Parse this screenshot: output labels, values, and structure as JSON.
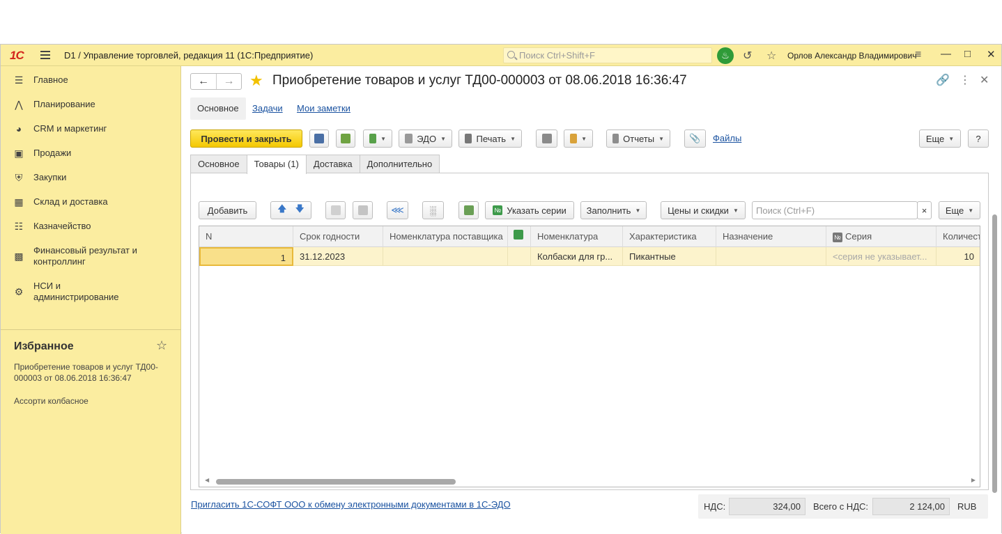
{
  "app": {
    "logo": "1С",
    "title": "D1 / Управление торговлей, редакция 11  (1С:Предприятие)",
    "search_placeholder": "Поиск Ctrl+Shift+F",
    "user": "Орлов Александр Владимирович"
  },
  "sidebar": {
    "items": [
      {
        "label": "Главное",
        "icon": "list-icon"
      },
      {
        "label": "Планирование",
        "icon": "planning-icon"
      },
      {
        "label": "CRM и маркетинг",
        "icon": "pie-chart-icon"
      },
      {
        "label": "Продажи",
        "icon": "shopping-bag-icon"
      },
      {
        "label": "Закупки",
        "icon": "cart-icon"
      },
      {
        "label": "Склад и доставка",
        "icon": "grid-icon"
      },
      {
        "label": "Казначейство",
        "icon": "coins-icon"
      },
      {
        "label": "Финансовый результат и контроллинг",
        "icon": "bar-chart-icon"
      },
      {
        "label": "НСИ и администрирование",
        "icon": "gear-icon"
      }
    ],
    "favorites_title": "Избранное",
    "favorites": [
      "Приобретение товаров и услуг ТД00-000003 от 08.06.2018 16:36:47",
      "Ассорти колбасное"
    ]
  },
  "document": {
    "title": "Приобретение товаров и услуг ТД00-000003 от 08.06.2018 16:36:47",
    "sections": {
      "active": "Основное",
      "links": [
        "Задачи",
        "Мои заметки"
      ]
    },
    "toolbar": {
      "post_close": "Провести и закрыть",
      "edo": "ЭДО",
      "print": "Печать",
      "reports": "Отчеты",
      "files": "Файлы",
      "more": "Еще",
      "help": "?"
    },
    "tabs": [
      "Основное",
      "Товары (1)",
      "Доставка",
      "Дополнительно"
    ],
    "active_tab": "Товары (1)",
    "goods_toolbar": {
      "add": "Добавить",
      "series": "Указать серии",
      "fill": "Заполнить",
      "prices": "Цены и скидки",
      "search_placeholder": "Поиск (Ctrl+F)",
      "clear": "×",
      "more": "Еще"
    },
    "table": {
      "columns": [
        "N",
        "Срок годности",
        "Номенклатура поставщика",
        "",
        "Номенклатура",
        "Характеристика",
        "Назначение",
        "Серия",
        "Количест"
      ],
      "rows": [
        [
          "1",
          "31.12.2023",
          "",
          "",
          "Колбаски для гр...",
          "Пикантные",
          "",
          "<серия не указывает...",
          "10"
        ]
      ]
    },
    "edo_invite": "Пригласить 1С-СОФТ ООО к обмену электронными документами в 1С-ЭДО",
    "totals": {
      "vat_label": "НДС:",
      "vat": "324,00",
      "total_label": "Всего с НДС:",
      "total": "2 124,00",
      "currency": "RUB"
    }
  }
}
